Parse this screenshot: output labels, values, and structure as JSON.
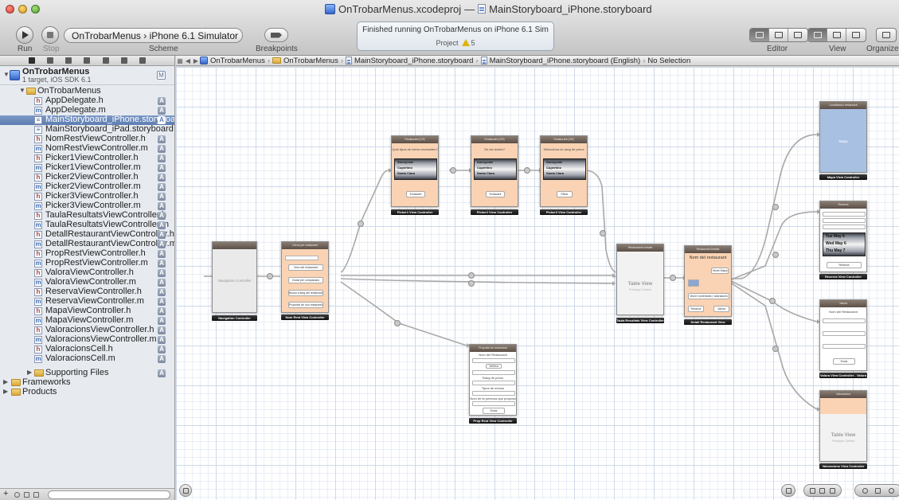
{
  "window": {
    "title_project": "OnTrobarMenus.xcodeproj",
    "title_sep": "—",
    "title_file": "MainStoryboard_iPhone.storyboard"
  },
  "toolbar": {
    "run_label": "Run",
    "stop_label": "Stop",
    "scheme_label": "Scheme",
    "scheme_value": "OnTrobarMenus  ›  iPhone 6.1 Simulator",
    "breakpoints_label": "Breakpoints",
    "activity_status": "Finished running OnTrobarMenus on iPhone 6.1 Sim",
    "activity_project": "Project",
    "activity_warnings": "5",
    "editor_label": "Editor",
    "view_label": "View",
    "organizer_label": "Organizer"
  },
  "jumpbar": {
    "items": [
      "OnTrobarMenus",
      "OnTrobarMenus",
      "MainStoryboard_iPhone.storyboard",
      "MainStoryboard_iPhone.storyboard (English)",
      "No Selection"
    ]
  },
  "navigator": {
    "project_name": "OnTrobarMenus",
    "project_sub": "1 target, iOS SDK 6.1",
    "project_badge": "M",
    "group_name": "OnTrobarMenus",
    "files": [
      {
        "name": "AppDelegate.h",
        "kind": "h"
      },
      {
        "name": "AppDelegate.m",
        "kind": "m"
      },
      {
        "name": "MainStoryboard_iPhone.storyboard",
        "kind": "sb",
        "selected": true
      },
      {
        "name": "MainStoryboard_iPad.storyboard",
        "kind": "sb"
      },
      {
        "name": "NomRestViewController.h",
        "kind": "h"
      },
      {
        "name": "NomRestViewController.m",
        "kind": "m"
      },
      {
        "name": "Picker1ViewController.h",
        "kind": "h"
      },
      {
        "name": "Picker1ViewController.m",
        "kind": "m"
      },
      {
        "name": "Picker2ViewController.h",
        "kind": "h"
      },
      {
        "name": "Picker2ViewController.m",
        "kind": "m"
      },
      {
        "name": "Picker3ViewController.h",
        "kind": "h"
      },
      {
        "name": "Picker3ViewController.m",
        "kind": "m"
      },
      {
        "name": "TaulaResultatsViewController.h",
        "kind": "h"
      },
      {
        "name": "TaulaResultatsViewController.m",
        "kind": "m"
      },
      {
        "name": "DetallRestaurantViewController.h",
        "kind": "h"
      },
      {
        "name": "DetallRestaurantViewController.m",
        "kind": "m"
      },
      {
        "name": "PropRestViewController.h",
        "kind": "h"
      },
      {
        "name": "PropRestViewController.m",
        "kind": "m"
      },
      {
        "name": "ValoraViewController.h",
        "kind": "h"
      },
      {
        "name": "ValoraViewController.m",
        "kind": "m"
      },
      {
        "name": "ReservaViewController.h",
        "kind": "h"
      },
      {
        "name": "ReservaViewController.m",
        "kind": "m"
      },
      {
        "name": "MapaViewController.h",
        "kind": "h"
      },
      {
        "name": "MapaViewController.m",
        "kind": "m"
      },
      {
        "name": "ValoracionsViewController.h",
        "kind": "h"
      },
      {
        "name": "ValoracionsViewController.m",
        "kind": "m"
      },
      {
        "name": "ValoracionsCell.h",
        "kind": "h"
      },
      {
        "name": "ValoracionsCell.m",
        "kind": "m"
      }
    ],
    "file_badge": "A",
    "supporting_files": "Supporting Files",
    "frameworks": "Frameworks",
    "products": "Products",
    "add_symbol": "+"
  },
  "storyboard": {
    "nav_controller": {
      "title": "Navigation Controller",
      "label": "Navigation Controller"
    },
    "nom_rest": {
      "nav_title": "Cerca per restaurant",
      "label": "Nom Rest View Controller",
      "buttons": [
        "Nom del restaurant",
        "Ciutat per comparacio",
        "Busca a llarg del restaurant",
        "Proposta de nou restaurant"
      ]
    },
    "picker1": {
      "nav_title": "Restaurant (1/3)",
      "question": "Quin tipus de menu necessiteu?",
      "rows": [
        "Sunnyvale",
        "Cupertino",
        "Santa Clara"
      ],
      "button": "Endavant",
      "label": "Picker1 View Controller"
    },
    "picker2": {
      "nav_title": "Restaurant (2/3)",
      "question": "On ets trobes?",
      "rows": [
        "Sunnyvale",
        "Cupertino",
        "Santa Clara"
      ],
      "button": "Endavant",
      "label": "Picker2 View Controller"
    },
    "picker3": {
      "nav_title": "Restaurant (3/3)",
      "question": "Selecciona un rang de preus",
      "rows": [
        "Sunnyvale",
        "Cupertino",
        "Santa Clara"
      ],
      "button": "Filtrar",
      "label": "Picker3 View Controller"
    },
    "taula": {
      "nav_title": "Restaurants trobats",
      "big": "Table View",
      "small": "Prototype Content",
      "label": "Taula Resultats View Controller"
    },
    "detall": {
      "nav_title": "Restaurant Detalls",
      "heading": "Nom del restaurant",
      "btn_map": "Veure Mapa",
      "btn_valoracions": "Veure comentaris i valoracions",
      "btn_reserva": "Reserva",
      "btn_valora": "Valora",
      "label": "Detall Restaurant View"
    },
    "proposta": {
      "nav_title": "Proposta de restaurant",
      "heading": "Nom del Restaurant",
      "btn1": "Verifica",
      "sub1": "Rang de preus",
      "sub2": "Tipus de menus",
      "sub3": "Nom de la persona que proposa",
      "button": "Envia",
      "label": "Prop Rest View Controller"
    },
    "mapa": {
      "nav_title": "Localitzacio restaurant",
      "body": "Mapa",
      "label": "Mapa View Controller"
    },
    "reserva": {
      "nav_title": "Reserva",
      "dates": [
        "Tue May 6",
        "Wed May 6",
        "Thu May 7"
      ],
      "button": "Reserva",
      "label": "Reserva View Controller"
    },
    "valora": {
      "nav_title": "Valora",
      "heading": "Nom del Restaurant",
      "button": "Envia",
      "label": "Valora View Controller - Valora"
    },
    "valoracions": {
      "nav_title": "Valoracions",
      "big": "Table View",
      "small": "Prototype Content",
      "label": "Valoracions View Controller"
    }
  },
  "colors": {
    "scene_peach": "#f9d3b4",
    "selection": "#5d7db2",
    "warning": "#e0b400"
  }
}
